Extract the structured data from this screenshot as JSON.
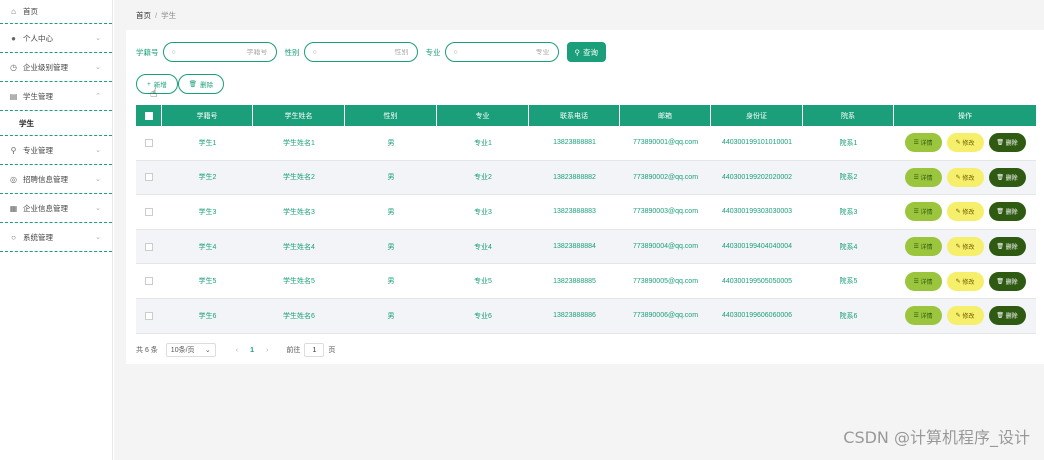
{
  "sidebar": {
    "items": [
      {
        "label": "首页",
        "icon": "home-icon",
        "glyph": "⌂"
      },
      {
        "label": "个人中心",
        "icon": "user-icon",
        "glyph": "●"
      },
      {
        "label": "企业级别管理",
        "icon": "clock-icon",
        "glyph": "◷"
      },
      {
        "label": "学生管理",
        "icon": "doc-icon",
        "glyph": "▤"
      },
      {
        "label": "专业管理",
        "icon": "mic-icon",
        "glyph": "⚲"
      },
      {
        "label": "招聘信息管理",
        "icon": "globe-icon",
        "glyph": "◎"
      },
      {
        "label": "企业信息管理",
        "icon": "building-icon",
        "glyph": "▦"
      },
      {
        "label": "系统管理",
        "icon": "info-icon",
        "glyph": "○"
      }
    ],
    "submenu": {
      "label": "学生"
    }
  },
  "breadcrumb": {
    "home": "首页",
    "sep": "/",
    "current": "学生"
  },
  "search": {
    "field1_label": "学籍号",
    "field1_placeholder": "学籍号",
    "field2_label": "性别",
    "field2_placeholder": "性别",
    "field3_label": "专业",
    "field3_placeholder": "专业",
    "query_label": "查询"
  },
  "actions": {
    "add_label": "新增",
    "delete_label": "删除"
  },
  "table": {
    "headers": [
      "学籍号",
      "学生姓名",
      "性别",
      "专业",
      "联系电话",
      "邮箱",
      "身份证",
      "院系",
      "操作"
    ],
    "rows": [
      [
        "学生1",
        "学生姓名1",
        "男",
        "专业1",
        "13823888881",
        "773890001@qq.com",
        "440300199101010001",
        "院系1"
      ],
      [
        "学生2",
        "学生姓名2",
        "男",
        "专业2",
        "13823888882",
        "773890002@qq.com",
        "440300199202020002",
        "院系2"
      ],
      [
        "学生3",
        "学生姓名3",
        "男",
        "专业3",
        "13823888883",
        "773890003@qq.com",
        "440300199303030003",
        "院系3"
      ],
      [
        "学生4",
        "学生姓名4",
        "男",
        "专业4",
        "13823888884",
        "773890004@qq.com",
        "440300199404040004",
        "院系4"
      ],
      [
        "学生5",
        "学生姓名5",
        "男",
        "专业5",
        "13823888885",
        "773890005@qq.com",
        "440300199505050005",
        "院系5"
      ],
      [
        "学生6",
        "学生姓名6",
        "男",
        "专业6",
        "13823888886",
        "773890006@qq.com",
        "440300199606060006",
        "院系6"
      ]
    ],
    "op_detail": "详情",
    "op_edit": "修改",
    "op_delete": "删除"
  },
  "pager": {
    "total": "共 6 条",
    "size": "10条/页",
    "page": "1",
    "goto": "前往",
    "goto_value": "1",
    "unit": "页"
  },
  "watermark": "CSDN @计算机程序_设计",
  "colors": {
    "accent": "#1a9f7a",
    "detail": "#9bc53d",
    "edit": "#f6ef6b",
    "delete": "#2e5a12"
  }
}
